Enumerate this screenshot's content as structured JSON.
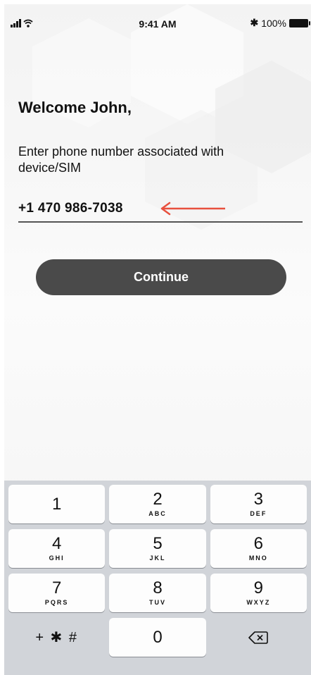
{
  "status_bar": {
    "time": "9:41 AM",
    "bluetooth": "✱",
    "battery": "100%",
    "icons": [
      "signal-icon",
      "wifi-icon",
      "bluetooth-icon",
      "battery-icon"
    ]
  },
  "welcome": {
    "title": "Welcome John,"
  },
  "form": {
    "instruction": "Enter phone number associated with device/SIM",
    "phone_value": "+1 470 986-7038",
    "annotation_icon": "arrow-left-icon",
    "annotation_color": "#e8503e"
  },
  "continue_button": {
    "label": "Continue",
    "color": "#4a4a4a"
  },
  "keypad": {
    "keys": [
      {
        "digit": "1",
        "letters": ""
      },
      {
        "digit": "2",
        "letters": "ABC"
      },
      {
        "digit": "3",
        "letters": "DEF"
      },
      {
        "digit": "4",
        "letters": "GHI"
      },
      {
        "digit": "5",
        "letters": "JKL"
      },
      {
        "digit": "6",
        "letters": "MNO"
      },
      {
        "digit": "7",
        "letters": "PQRS"
      },
      {
        "digit": "8",
        "letters": "TUV"
      },
      {
        "digit": "9",
        "letters": "WXYZ"
      },
      {
        "digit": "0",
        "letters": ""
      }
    ],
    "symbols_key": "+ ✱ #",
    "delete_icon": "backspace-icon"
  }
}
